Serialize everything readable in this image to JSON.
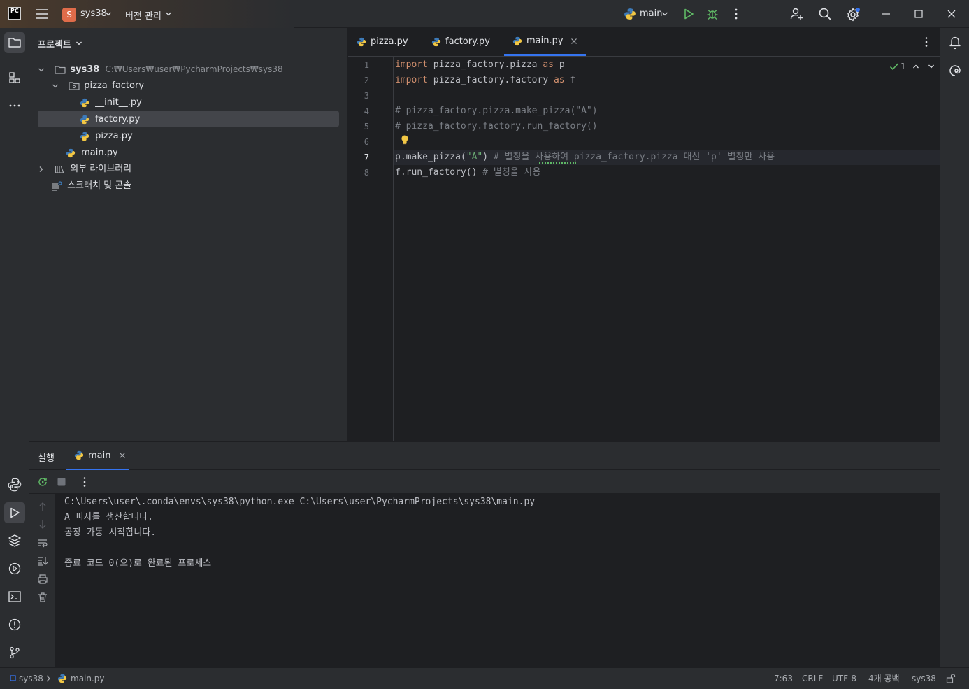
{
  "titlebar": {
    "logo": "PC",
    "project_badge": "S",
    "project_name": "sys38",
    "vcs_label": "버전 관리",
    "run_config": "main"
  },
  "project_panel": {
    "title": "프로젝트",
    "root_name": "sys38",
    "root_path": "C:₩Users₩user₩PycharmProjects₩sys38",
    "items": [
      {
        "label": "pizza_factory"
      },
      {
        "label": "__init__.py"
      },
      {
        "label": "factory.py"
      },
      {
        "label": "pizza.py"
      },
      {
        "label": "main.py"
      },
      {
        "label": "외부 라이브러리"
      },
      {
        "label": "스크래치 및 콘솔"
      }
    ]
  },
  "editor": {
    "tabs": [
      {
        "label": "pizza.py"
      },
      {
        "label": "factory.py"
      },
      {
        "label": "main.py"
      }
    ],
    "inspection_count": "1",
    "line_numbers": [
      "1",
      "2",
      "3",
      "4",
      "5",
      "6",
      "7",
      "8"
    ],
    "lines": {
      "l1_kw": "import",
      "l1_mod": " pizza_factory.pizza ",
      "l1_as": "as",
      "l1_alias": " p",
      "l2_kw": "import",
      "l2_mod": " pizza_factory.factory ",
      "l2_as": "as",
      "l2_alias": " f",
      "l4": "# pizza_factory.pizza.make_pizza(\"A\")",
      "l5": "# pizza_factory.factory.run_factory()",
      "l7_code_a": "p.make_pizza(",
      "l7_str": "\"A\"",
      "l7_code_b": ") ",
      "l7_cm": "# 별칭을 사용하여 pizza_factory.pizza 대신 'p' 별칭만 사용",
      "l8_code": "f.run_factory() ",
      "l8_cm": "# 별칭을 사용"
    }
  },
  "run_panel": {
    "title": "실행",
    "tab": "main",
    "output": [
      "C:\\Users\\user\\.conda\\envs\\sys38\\python.exe C:\\Users\\user\\PycharmProjects\\sys38\\main.py",
      "A 피자를 생산합니다.",
      "공장 가동 시작합니다.",
      "",
      "종료 코드 0(으)로 완료된 프로세스"
    ]
  },
  "statusbar": {
    "breadcrumb_project": "sys38",
    "breadcrumb_file": "main.py",
    "position": "7:63",
    "line_ending": "CRLF",
    "encoding": "UTF-8",
    "indent": "4개 공백",
    "interpreter": "sys38"
  },
  "colors": {
    "accent": "#3574f0",
    "run_green": "#5fb865",
    "keyword": "#cf8e6d",
    "string": "#6aab73",
    "comment": "#7a7e85"
  }
}
